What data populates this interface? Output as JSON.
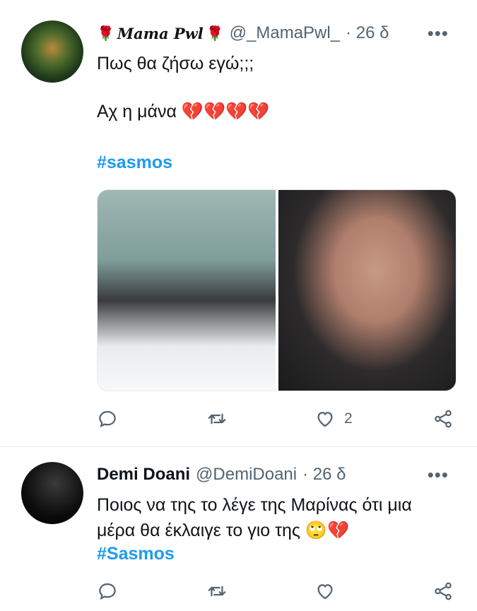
{
  "tweets": [
    {
      "name_left_decor": "🌹",
      "name": "Mama Pwl",
      "name_right_decor": "🌹",
      "handle": "@_MamaPwl_",
      "time": "· 26 δ",
      "more": "•••",
      "line1": "Πως θα ζήσω εγώ;;;",
      "line2": "Αχ η μάνα 💔💔💔💔",
      "hashtag": "#sasmos",
      "actions": {
        "reply": "",
        "retweet": "",
        "like": "2",
        "share": ""
      }
    },
    {
      "name": "Demi Doani",
      "handle": "@DemiDoani",
      "time": "· 26 δ",
      "more": "•••",
      "line1": "Ποιος να της το λέγε της Μαρίνας ότι μια",
      "line2": "μέρα θα έκλαιγε το γιο της 🙄💔",
      "hashtag": "#Sasmos",
      "actions": {
        "reply": "",
        "retweet": "",
        "like": "",
        "share": ""
      }
    }
  ],
  "colors": {
    "text": "#0f1419",
    "secondary": "#536471",
    "link": "#1d9bf0",
    "divider": "#e6ecf0"
  }
}
